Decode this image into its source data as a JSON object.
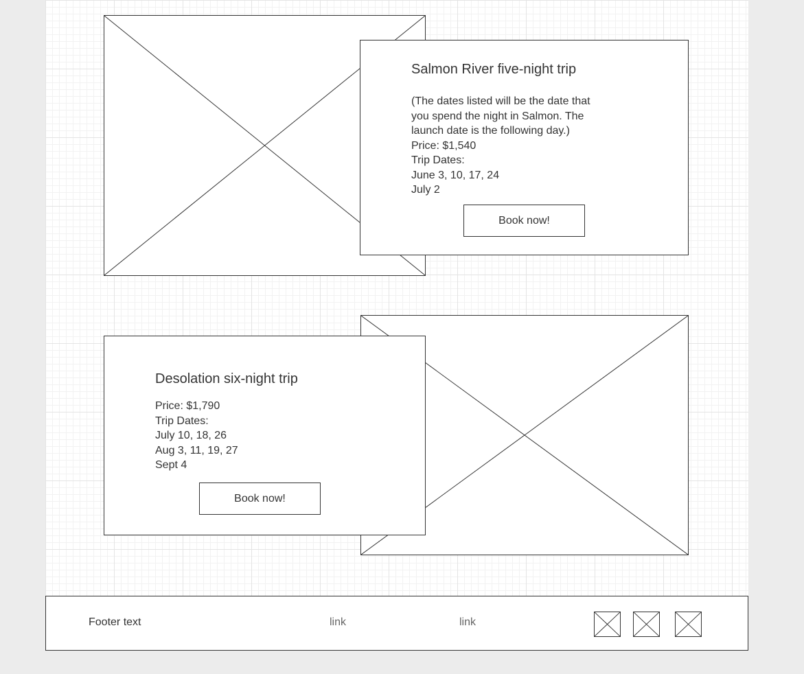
{
  "trips": [
    {
      "title": "Salmon River five-night trip",
      "note_lines": [
        "(The dates listed will be the date that",
        "you spend the night in Salmon. The",
        "launch date is the following day.)"
      ],
      "price": "Price: $1,540",
      "dates_label": "Trip Dates:",
      "dates": [
        "June 3, 10, 17, 24",
        "July 2"
      ],
      "button_label": "Book now!"
    },
    {
      "title": "Desolation six-night trip",
      "price": "Price: $1,790",
      "dates_label": "Trip Dates:",
      "dates": [
        "July 10, 18, 26",
        "Aug 3, 11, 19, 27",
        "Sept 4"
      ],
      "button_label": "Book now!"
    }
  ],
  "footer": {
    "text": "Footer text",
    "links": [
      "link",
      "link"
    ],
    "social_icons": [
      "image-placeholder-icon",
      "image-placeholder-icon",
      "image-placeholder-icon"
    ]
  }
}
